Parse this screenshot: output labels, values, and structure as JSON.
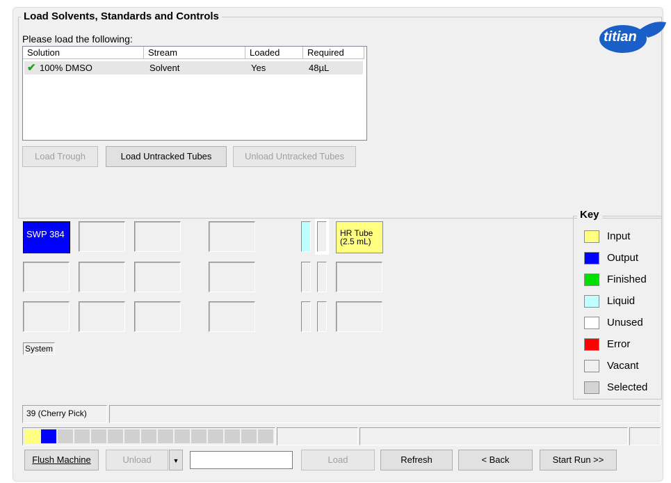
{
  "group": {
    "title": "Load Solvents, Standards and Controls",
    "prompt": "Please load the following:"
  },
  "logo": {
    "text": "titian"
  },
  "table": {
    "headers": [
      "Solution",
      "Stream",
      "Loaded",
      "Required"
    ],
    "rows": [
      {
        "solution": "100% DMSO",
        "stream": "Solvent",
        "loaded": "Yes",
        "required": "48µL"
      }
    ]
  },
  "buttons": {
    "load_trough": "Load Trough",
    "load_untracked": "Load Untracked Tubes",
    "unload_untracked": "Unload Untracked Tubes"
  },
  "deck": {
    "swp": "SWP 384",
    "hr_tube": "HR Tube\n(2.5 mL)",
    "system": "System"
  },
  "key": {
    "title": "Key",
    "items": [
      {
        "label": "Input",
        "color": "#ffff80"
      },
      {
        "label": "Output",
        "color": "#0000ff"
      },
      {
        "label": "Finished",
        "color": "#00e000"
      },
      {
        "label": "Liquid",
        "color": "#c0ffff"
      },
      {
        "label": "Unused",
        "color": "#ffffff"
      },
      {
        "label": "Error",
        "color": "#ff0000"
      },
      {
        "label": "Vacant",
        "color": "#f0f0f0"
      },
      {
        "label": "Selected",
        "color": "#d4d4d4"
      }
    ]
  },
  "status": {
    "task": "39 (Cherry Pick)"
  },
  "progress_colors": [
    "#ffff80",
    "#0000ff",
    "#d0d0d0",
    "#d0d0d0",
    "#d0d0d0",
    "#d0d0d0",
    "#d0d0d0",
    "#d0d0d0",
    "#d0d0d0",
    "#d0d0d0",
    "#d0d0d0",
    "#d0d0d0",
    "#d0d0d0",
    "#d0d0d0",
    "#d0d0d0"
  ],
  "bottom": {
    "flush": "Flush Machine",
    "unload": "Unload",
    "load": "Load",
    "refresh": "Refresh",
    "back": "< Back",
    "start": "Start Run >>",
    "input_value": ""
  }
}
